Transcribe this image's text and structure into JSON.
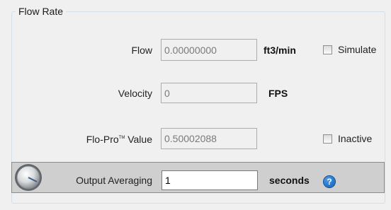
{
  "group": {
    "title": "Flow Rate"
  },
  "flow": {
    "label": "Flow",
    "value": "0.00000000",
    "unit": "ft3/min",
    "checkbox_label": "Simulate",
    "checked": false
  },
  "velocity": {
    "label": "Velocity",
    "value": "0",
    "unit": "FPS"
  },
  "flopro": {
    "label_main": "Flo-Pro",
    "label_mark": "TM",
    "label_tail": " Value",
    "value": "0.50002088",
    "checkbox_label": "Inactive",
    "checked": false
  },
  "averaging": {
    "label": "Output Averaging",
    "value": "1",
    "unit": "seconds",
    "knob_icon": "rotary-knob-icon",
    "help_icon": "help-icon",
    "help_glyph": "?"
  },
  "colors": {
    "window_bg": "#f0f0f0",
    "panel_bg": "#cfcfcf",
    "help_blue": "#1a6fcf"
  }
}
